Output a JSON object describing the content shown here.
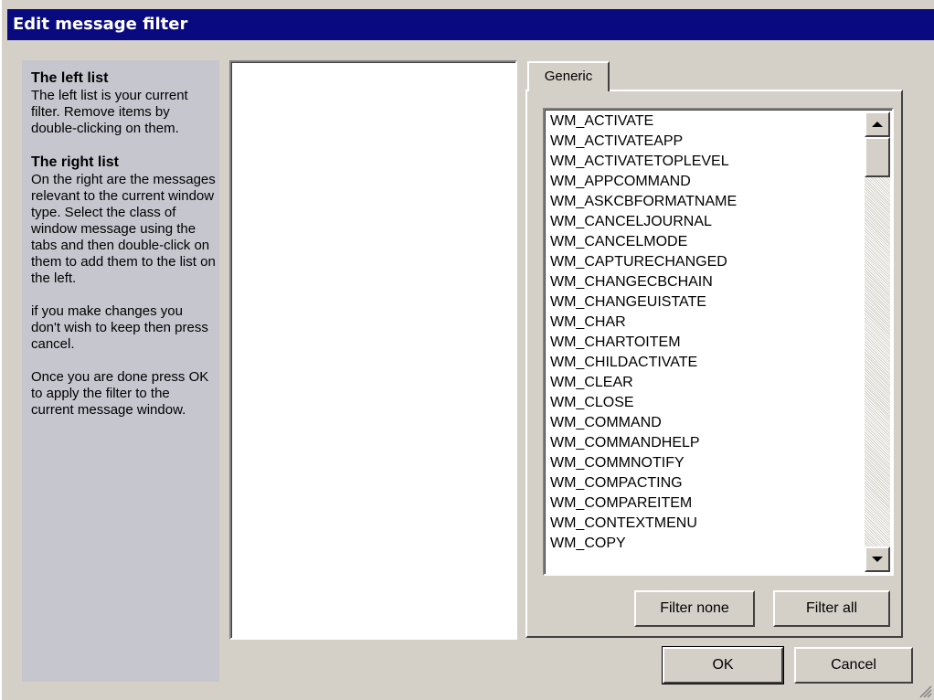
{
  "window": {
    "title": "Edit message filter"
  },
  "help": {
    "left_heading": "The left list",
    "left_text": "The left list is your current filter. Remove items by double-clicking on them.",
    "right_heading": "The right list",
    "right_text": "On the right are the messages relevant to the current window type. Select the class of window message using the tabs and then double-click on them to add them to the list on the left.",
    "cancel_text": "if you make changes you don't wish to keep then press cancel.",
    "ok_text": "Once you are done press OK to apply the filter to the current message window."
  },
  "tabs": [
    {
      "label": "Generic",
      "selected": true
    }
  ],
  "messages": [
    "WM_ACTIVATE",
    "WM_ACTIVATEAPP",
    "WM_ACTIVATETOPLEVEL",
    "WM_APPCOMMAND",
    "WM_ASKCBFORMATNAME",
    "WM_CANCELJOURNAL",
    "WM_CANCELMODE",
    "WM_CAPTURECHANGED",
    "WM_CHANGECBCHAIN",
    "WM_CHANGEUISTATE",
    "WM_CHAR",
    "WM_CHARTOITEM",
    "WM_CHILDACTIVATE",
    "WM_CLEAR",
    "WM_CLOSE",
    "WM_COMMAND",
    "WM_COMMANDHELP",
    "WM_COMMNOTIFY",
    "WM_COMPACTING",
    "WM_COMPAREITEM",
    "WM_CONTEXTMENU",
    "WM_COPY"
  ],
  "buttons": {
    "filter_none": "Filter none",
    "filter_all": "Filter all",
    "ok": "OK",
    "cancel": "Cancel"
  },
  "colors": {
    "titlebar": "#0a0a80",
    "help_panel": "#c6c6ce",
    "face": "#d4d0c8"
  }
}
